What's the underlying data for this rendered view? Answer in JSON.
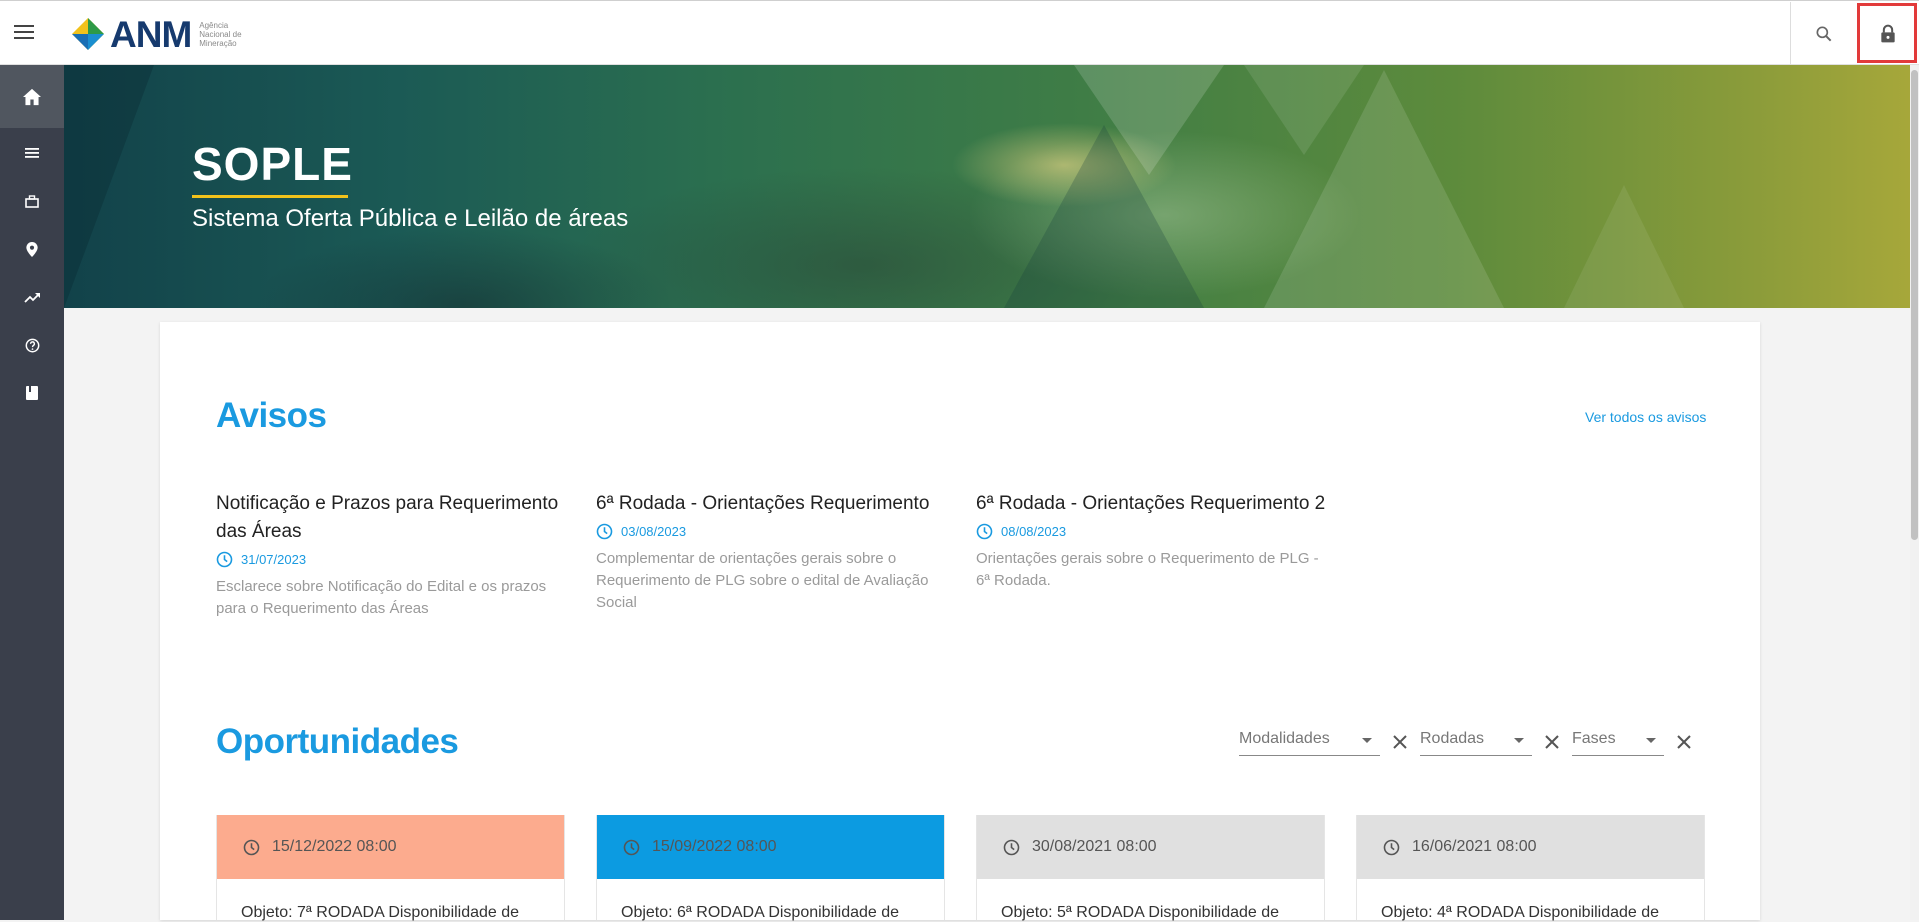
{
  "header": {
    "logo_text": "ANM",
    "logo_sub_line1": "Agência",
    "logo_sub_line2": "Nacional de",
    "logo_sub_line3": "Mineração"
  },
  "hero": {
    "title": "SOPLE",
    "subtitle": "Sistema Oferta Pública e Leilão de áreas"
  },
  "avisos": {
    "title": "Avisos",
    "see_all": "Ver todos os avisos",
    "items": [
      {
        "title": "Notificação e Prazos para Requerimento das Áreas",
        "date": "31/07/2023",
        "desc": "Esclarece sobre Notificação do Edital e os prazos para o Requerimento das Áreas"
      },
      {
        "title": "6ª Rodada - Orientações Requerimento",
        "date": "03/08/2023",
        "desc": "Complementar de orientações gerais sobre o Requerimento de PLG sobre o edital de Avaliação Social"
      },
      {
        "title": "6ª Rodada - Orientações Requerimento 2",
        "date": "08/08/2023",
        "desc": "Orientações gerais sobre o Requerimento de PLG - 6ª Rodada."
      }
    ]
  },
  "oportunidades": {
    "title": "Oportunidades",
    "filters": [
      "Modalidades",
      "Rodadas",
      "Fases"
    ],
    "items": [
      {
        "date": "15/12/2022 08:00",
        "color": "#fcab8e",
        "text": "Objeto: 7ª RODADA Disponibilidade de"
      },
      {
        "date": "15/09/2022 08:00",
        "color": "#0c9be1",
        "text": "Objeto: 6ª RODADA Disponibilidade de"
      },
      {
        "date": "30/08/2021 08:00",
        "color": "#e0e0e0",
        "text": "Objeto: 5ª RODADA Disponibilidade de"
      },
      {
        "date": "16/06/2021 08:00",
        "color": "#e0e0e0",
        "text": "Objeto: 4ª RODADA Disponibilidade de"
      }
    ]
  },
  "icons": {
    "menu": "menu-icon",
    "search": "search-icon",
    "lock": "lock-icon",
    "sidebar": [
      "home-icon",
      "list-icon",
      "briefcase-icon",
      "location-pin-icon",
      "trending-up-icon",
      "help-icon",
      "book-icon"
    ]
  },
  "colors": {
    "accent": "#1a9ae0",
    "sidebar_bg": "#3a3f4b",
    "hero_underline": "#f2c21b",
    "annotation_red": "#e23a3a"
  }
}
